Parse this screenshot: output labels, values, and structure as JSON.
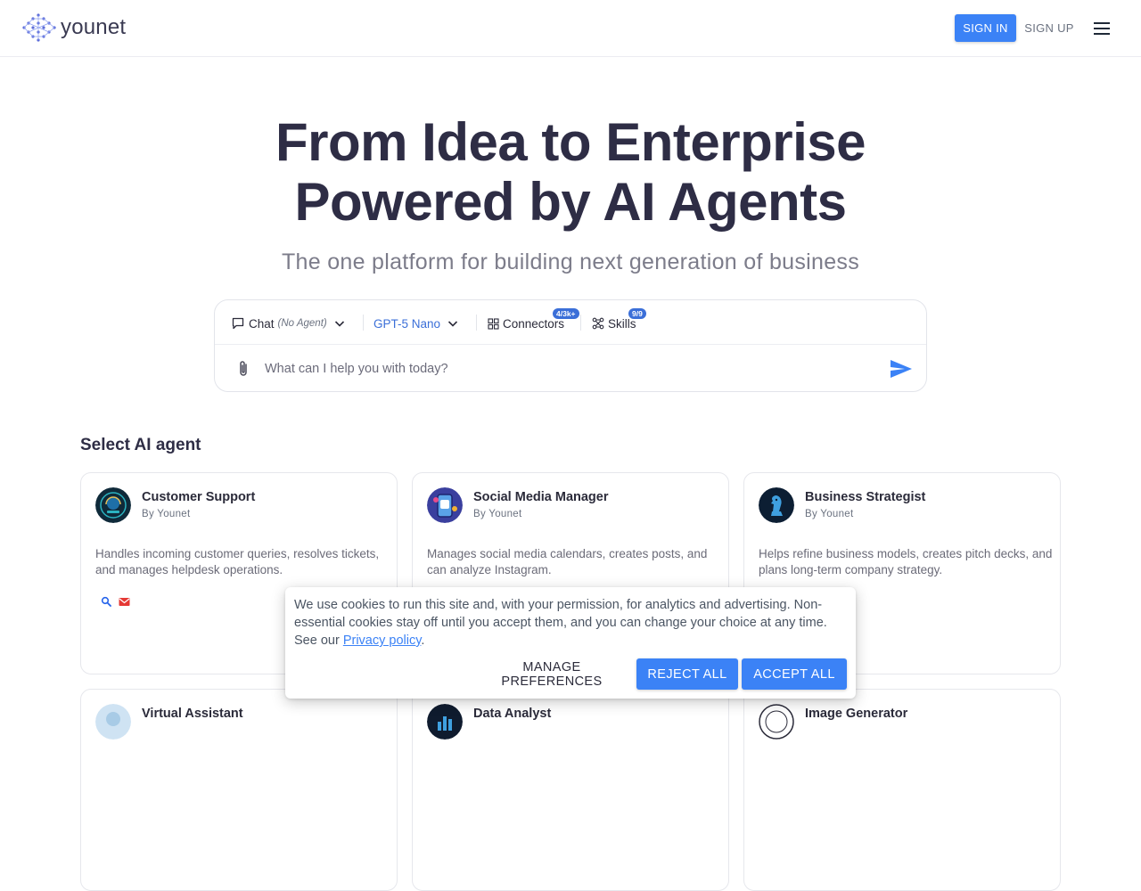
{
  "header": {
    "logo_text": "younet",
    "signin_label": "SIGN IN",
    "signup_label": "SIGN UP",
    "menu_icon": "hamburger-menu-icon"
  },
  "hero": {
    "title_line1": "From Idea to Enterprise",
    "title_line2": "Powered by AI Agents",
    "subtitle": "The one platform for building next generation of business"
  },
  "chat": {
    "mode_label": "Chat",
    "mode_agent": "(No Agent)",
    "model_label": "GPT-5 Nano",
    "connectors_label": "Connectors",
    "connectors_badge": "4/3k+",
    "skills_label": "Skills",
    "skills_badge": "9/9",
    "input_placeholder": "What can I help you with today?",
    "icons": [
      "chat-bubble-icon",
      "chevron-down-icon",
      "grid-icon",
      "skills-icon",
      "paperclip-icon",
      "send-icon"
    ]
  },
  "agents": {
    "section_title": "Select AI agent",
    "cards": [
      {
        "title": "Customer Support",
        "by": "By Younet",
        "desc": "Handles incoming customer queries, resolves tickets, and manages helpdesk operations.",
        "tools": [
          "search-icon",
          "mail-icon"
        ]
      },
      {
        "title": "Social Media Manager",
        "by": "By Younet",
        "desc": "Manages social media calendars, creates posts, and can analyze Instagram."
      },
      {
        "title": "Business Strategist",
        "by": "By Younet",
        "desc": "Helps refine business models, creates pitch decks, and plans long-term company strategy."
      },
      {
        "title": "Virtual Assistant"
      },
      {
        "title": "Data Analyst"
      },
      {
        "title": "Image Generator"
      }
    ]
  },
  "cookie": {
    "text": "We use cookies to run this site and, with your permission, for analytics and advertising. Non-essential cookies stay off until you accept them, and you can change your choice at any time. See our ",
    "link": "Privacy policy",
    "tail": ".",
    "manage_label": "MANAGE PREFERENCES",
    "reject_label": "REJECT ALL",
    "accept_label": "ACCEPT ALL"
  },
  "colors": {
    "accent": "#3b82f6",
    "heading": "#2e2d45",
    "link_blue": "#3b6fd8"
  }
}
